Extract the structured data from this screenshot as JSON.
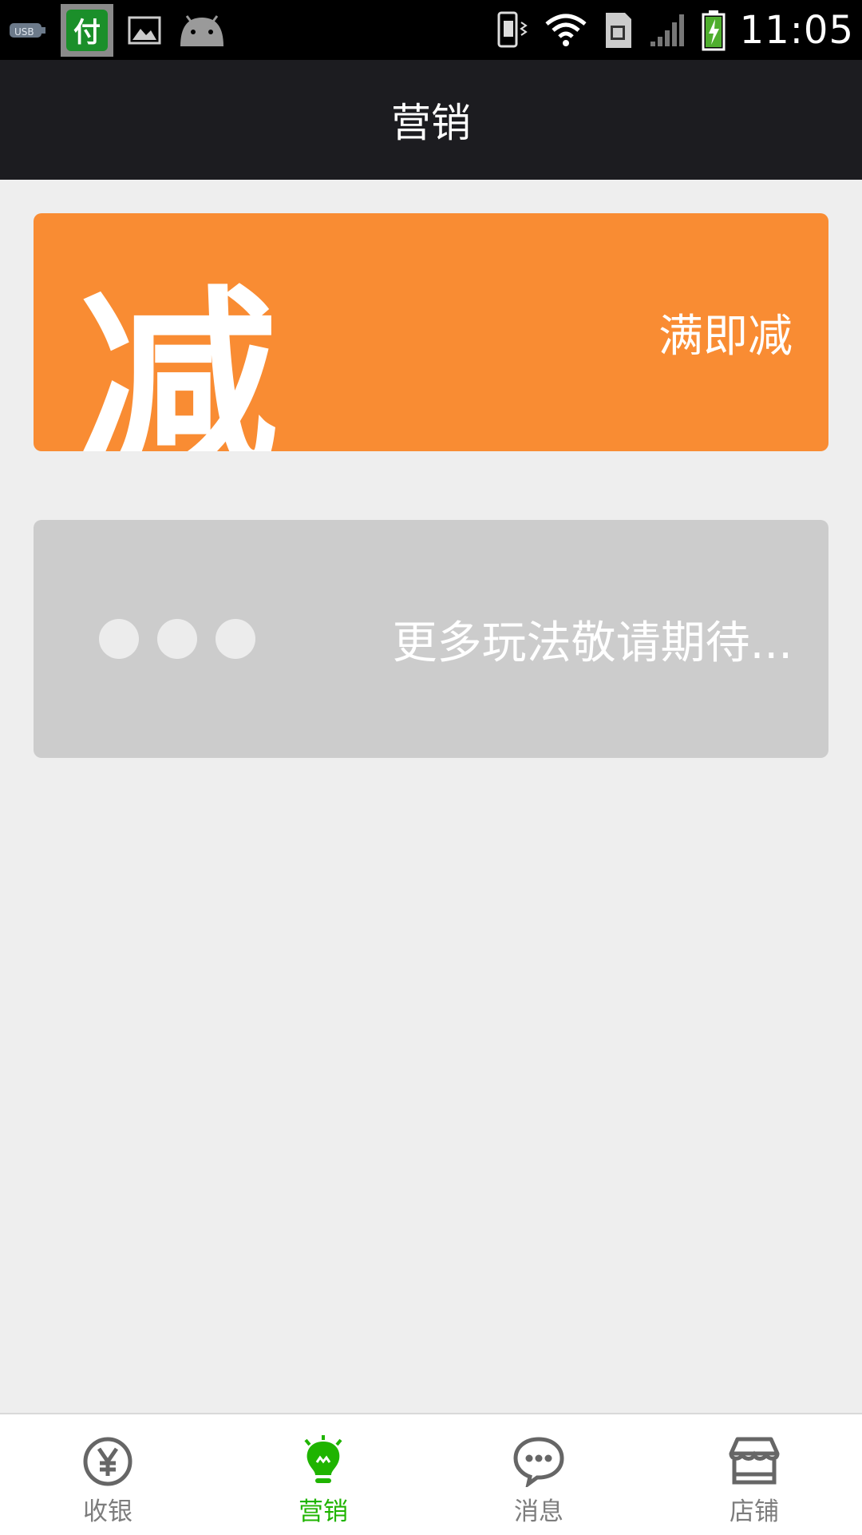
{
  "header": {
    "title": "营销"
  },
  "status_bar": {
    "time": "11:05",
    "app_badge": "付",
    "icons": [
      "usb-icon",
      "pay-app-icon",
      "image-icon",
      "android-icon",
      "vibrate-icon",
      "wifi-icon",
      "sim-icon",
      "signal-icon",
      "battery-charging-icon"
    ]
  },
  "cards": [
    {
      "label": "满即减",
      "big_char": "减",
      "color": "#f98c33"
    },
    {
      "label": "更多玩法敬请期待...",
      "color": "#cccccc"
    }
  ],
  "nav": [
    {
      "label": "收银",
      "icon": "yen-icon",
      "active": false
    },
    {
      "label": "营销",
      "icon": "lightbulb-icon",
      "active": true
    },
    {
      "label": "消息",
      "icon": "chat-bubble-icon",
      "active": false
    },
    {
      "label": "店铺",
      "icon": "store-icon",
      "active": false
    }
  ],
  "colors": {
    "accent": "#1fb400",
    "titlebar": "#1c1c20",
    "background": "#eeeeee"
  }
}
